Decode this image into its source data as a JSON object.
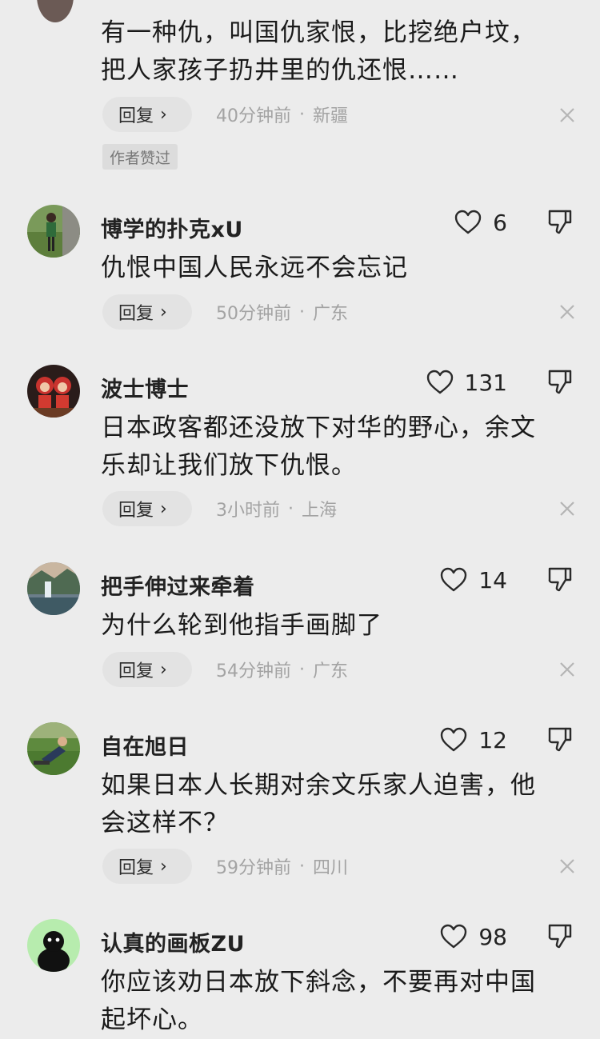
{
  "top_comment": {
    "content_line1": "有一种仇，叫国仇家恨，比挖绝户坟，",
    "content_line2": "把人家孩子扔井里的仇还恨……",
    "reply_label": "回复",
    "time": "40分钟前",
    "location": "新疆",
    "author_liked_badge": "作者赞过"
  },
  "comments": [
    {
      "username": "博学的扑克xU",
      "likes": "6",
      "content_line1": "仇恨中国人民永远不会忘记",
      "content_line2": "",
      "reply_label": "回复",
      "time": "50分钟前",
      "location": "广东"
    },
    {
      "username": "波士博士",
      "likes": "131",
      "content_line1": "日本政客都还没放下对华的野心，余文",
      "content_line2": "乐却让我们放下仇恨。",
      "reply_label": "回复",
      "time": "3小时前",
      "location": "上海"
    },
    {
      "username": "把手伸过来牵着",
      "likes": "14",
      "content_line1": "为什么轮到他指手画脚了",
      "content_line2": "",
      "reply_label": "回复",
      "time": "54分钟前",
      "location": "广东"
    },
    {
      "username": "自在旭日",
      "likes": "12",
      "content_line1": "如果日本人长期对余文乐家人迫害，他",
      "content_line2": "会这样不？",
      "reply_label": "回复",
      "time": "59分钟前",
      "location": "四川"
    },
    {
      "username": "认真的画板ZU",
      "likes": "98",
      "content_line1": "你应该劝日本放下斜念，不要再对中国",
      "content_line2": "起坏心。"
    }
  ],
  "separator": "·",
  "icons": {
    "like": "heart-outline-icon",
    "dislike": "thumbs-down-icon",
    "close": "close-x-icon",
    "chevron": "chevron-right-icon"
  },
  "colors": {
    "background": "#ececec",
    "meta_text": "#a3a3a3",
    "reply_pill": "#e3e3e3"
  }
}
